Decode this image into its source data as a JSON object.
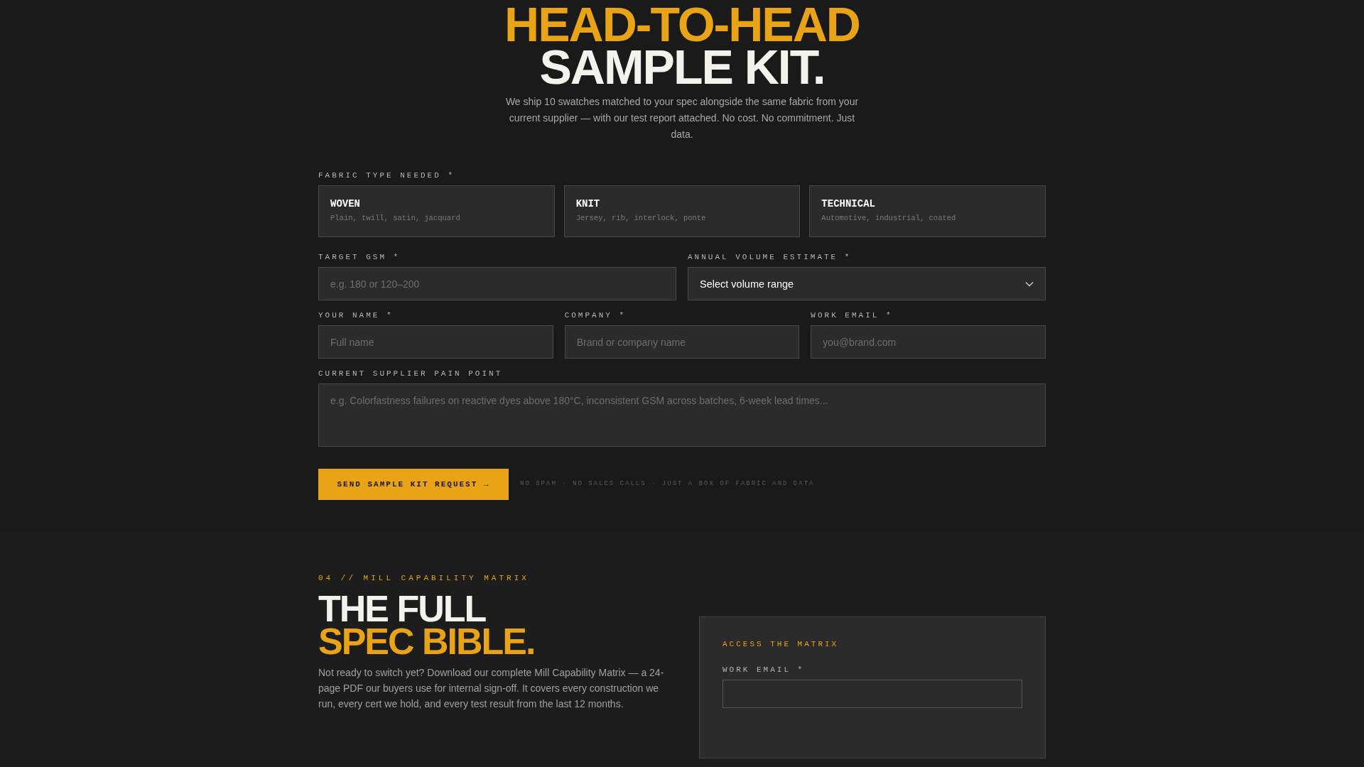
{
  "sample_kit": {
    "title_accent": "HEAD-TO-HEAD",
    "title": "SAMPLE KIT.",
    "intro": "We ship 10 swatches matched to your spec alongside the same fabric from your current supplier — with our test report attached. No cost. No commitment. Just data.",
    "fabric_label": "FABRIC TYPE NEEDED *",
    "fabric_types": [
      {
        "name": "WOVEN",
        "description": "Plain, twill, satin, jacquard",
        "selected": false
      },
      {
        "name": "KNIT",
        "description": "Jersey, rib, interlock, ponte",
        "selected": false
      },
      {
        "name": "TECHNICAL",
        "description": "Automotive, industrial, coated",
        "selected": false
      }
    ],
    "gsm": {
      "label": "TARGET GSM *",
      "placeholder": "e.g. 180 or 120–200"
    },
    "volume": {
      "label": "ANNUAL VOLUME ESTIMATE *",
      "value": "Select volume range"
    },
    "contact_fields": [
      {
        "label": "YOUR NAME *",
        "placeholder": "Full name"
      },
      {
        "label": "COMPANY *",
        "placeholder": "Brand or company name"
      },
      {
        "label": "WORK EMAIL *",
        "placeholder": "you@brand.com"
      }
    ],
    "pain_point": {
      "label": "CURRENT SUPPLIER PAIN POINT",
      "placeholder": "e.g. Colorfastness failures on reactive dyes above 180°C, inconsistent GSM across batches, 6-week lead times..."
    },
    "submit_button": "SEND SAMPLE KIT REQUEST →",
    "note": "NO SPAM · NO SALES CALLS · JUST A BOX OF FABRIC AND DATA"
  },
  "matrix": {
    "eyebrow": "04 // MILL CAPABILITY MATRIX",
    "title": "THE FULL",
    "title_accent": "SPEC BIBLE.",
    "description": "Not ready to switch yet? Download our complete Mill Capability Matrix — a 24-page PDF our buyers use for internal sign-off. It covers every construction we run, every cert we hold, and every test result from the last 12 months.",
    "access_card": {
      "heading": "ACCESS THE MATRIX",
      "email_label": "WORK EMAIL *"
    }
  }
}
